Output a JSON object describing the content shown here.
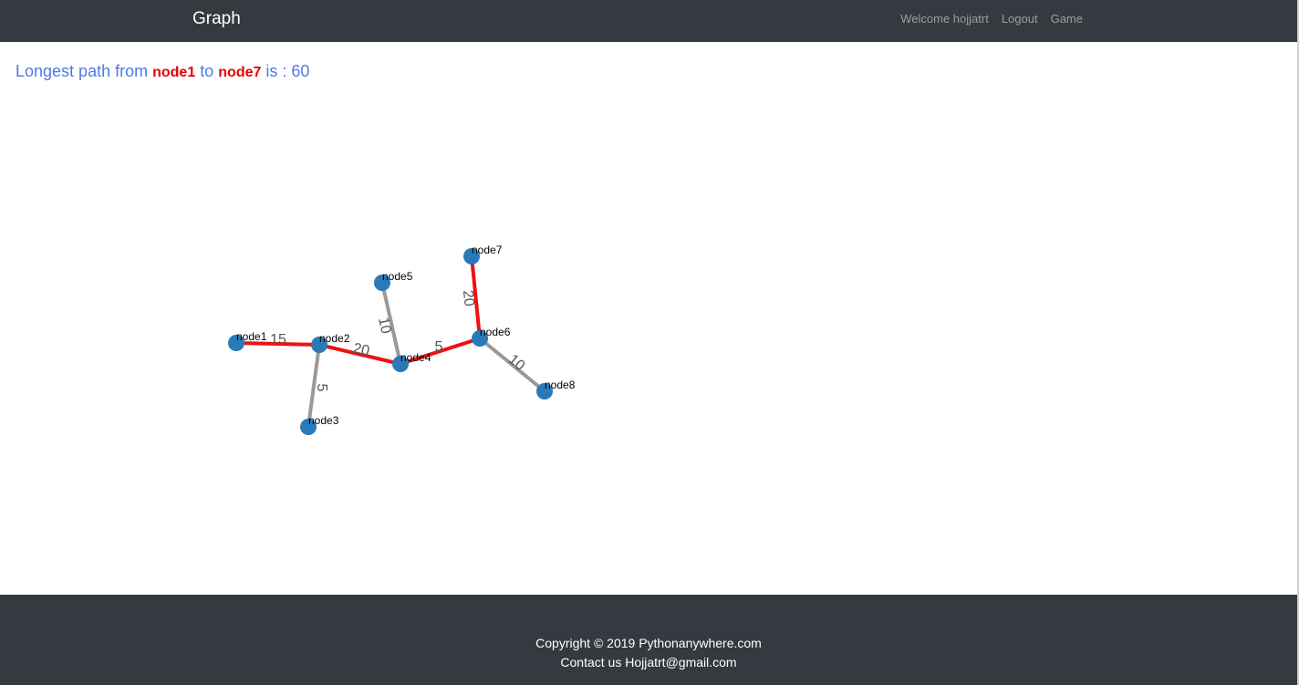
{
  "navbar": {
    "brand": "Graph",
    "links": [
      {
        "label": "Welcome hojjatrt"
      },
      {
        "label": "Logout"
      },
      {
        "label": "Game"
      }
    ]
  },
  "result": {
    "prefix": "Longest path from",
    "source": "node1",
    "connector": "to",
    "target": "node7",
    "suffix": "is : 60"
  },
  "graph": {
    "colors": {
      "node": "#2a7ab8",
      "path_edge": "#ee1111",
      "edge": "#999999",
      "weight_label": "#555555"
    },
    "nodes": [
      "node1",
      "node2",
      "node3",
      "node4",
      "node5",
      "node6",
      "node7",
      "node8"
    ],
    "edges": [
      {
        "from": "node1",
        "to": "node2",
        "weight": "15",
        "on_path": true
      },
      {
        "from": "node2",
        "to": "node3",
        "weight": "5",
        "on_path": false
      },
      {
        "from": "node2",
        "to": "node4",
        "weight": "20",
        "on_path": true
      },
      {
        "from": "node4",
        "to": "node5",
        "weight": "10",
        "on_path": false
      },
      {
        "from": "node4",
        "to": "node6",
        "weight": "5",
        "on_path": true
      },
      {
        "from": "node6",
        "to": "node7",
        "weight": "20",
        "on_path": true
      },
      {
        "from": "node6",
        "to": "node8",
        "weight": "10",
        "on_path": false
      }
    ]
  },
  "footer": {
    "copyright": "Copyright © 2019 Pythonanywhere.com",
    "contact": "Contact us Hojjatrt@gmail.com"
  }
}
